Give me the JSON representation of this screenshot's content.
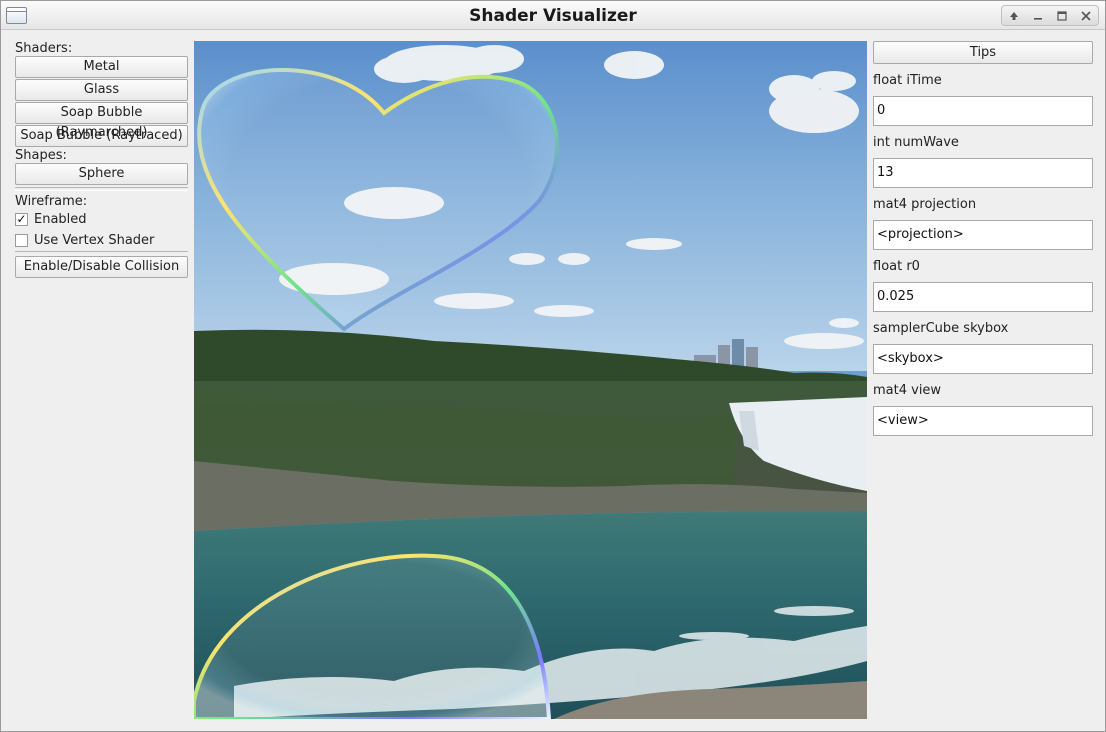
{
  "window": {
    "title": "Shader Visualizer"
  },
  "left_panel": {
    "shaders_label": "Shaders:",
    "shaders": [
      "Metal",
      "Glass",
      "Soap Bubble (Raymarched)",
      "Soap Bubble (Raytraced)"
    ],
    "shapes_label": "Shapes:",
    "shapes": [
      "Sphere"
    ],
    "wireframe_label": "Wireframe:",
    "enabled_label": "Enabled",
    "enabled_checked": true,
    "vertex_shader_label": "Use Vertex Shader",
    "vertex_shader_checked": false,
    "collision_button": "Enable/Disable Collision"
  },
  "right_panel": {
    "tips_button": "Tips",
    "uniforms": [
      {
        "label": "float iTime",
        "value": "0"
      },
      {
        "label": "int numWave",
        "value": "13"
      },
      {
        "label": "mat4 projection",
        "value": "<projection>"
      },
      {
        "label": "float r0",
        "value": "0.025"
      },
      {
        "label": "samplerCube skybox",
        "value": "<skybox>"
      },
      {
        "label": "mat4 view",
        "value": "<view>"
      }
    ]
  }
}
